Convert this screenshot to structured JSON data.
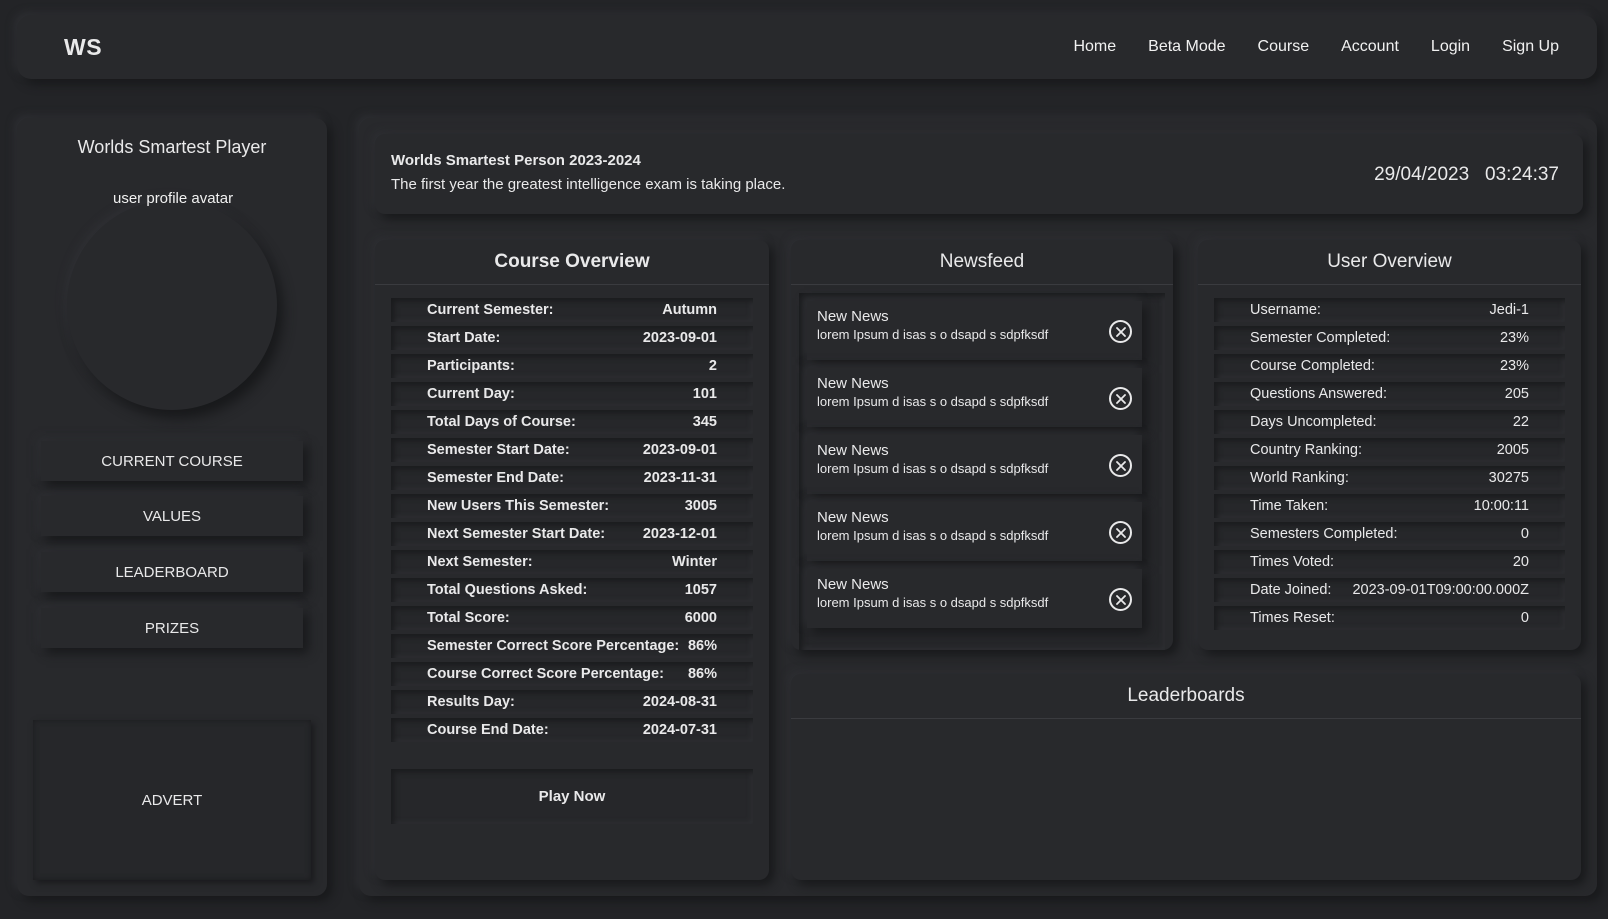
{
  "navbar": {
    "logo": "WS",
    "links": [
      "Home",
      "Beta Mode",
      "Course",
      "Account",
      "Login",
      "Sign Up"
    ]
  },
  "sidebar": {
    "title": "Worlds Smartest Player",
    "avatar_alt": "user profile avatar",
    "buttons": [
      "CURRENT COURSE",
      "VALUES",
      "LEADERBOARD",
      "PRIZES"
    ],
    "advert": "ADVERT"
  },
  "banner": {
    "title": "Worlds Smartest Person 2023-2024",
    "subtitle": "The first year the greatest intelligence exam is taking place.",
    "date": "29/04/2023",
    "time": "03:24:37"
  },
  "course_overview": {
    "title": "Course Overview",
    "rows": [
      {
        "label": "Current Semester:",
        "value": "Autumn"
      },
      {
        "label": "Start Date:",
        "value": "2023-09-01"
      },
      {
        "label": "Participants:",
        "value": "2"
      },
      {
        "label": "Current Day:",
        "value": "101"
      },
      {
        "label": "Total Days of Course:",
        "value": "345"
      },
      {
        "label": "Semester Start Date:",
        "value": "2023-09-01"
      },
      {
        "label": "Semester End Date:",
        "value": "2023-11-31"
      },
      {
        "label": "New Users This Semester:",
        "value": "3005"
      },
      {
        "label": "Next Semester Start Date:",
        "value": "2023-12-01"
      },
      {
        "label": "Next Semester:",
        "value": "Winter"
      },
      {
        "label": "Total Questions Asked:",
        "value": "1057"
      },
      {
        "label": "Total Score:",
        "value": "6000"
      },
      {
        "label": "Semester Correct Score Percentage:",
        "value": "86%"
      },
      {
        "label": "Course Correct Score Percentage:",
        "value": "86%"
      },
      {
        "label": "Results Day:",
        "value": "2024-08-31"
      },
      {
        "label": "Course End Date:",
        "value": "2024-07-31"
      }
    ],
    "play_button": "Play Now"
  },
  "newsfeed": {
    "title": "Newsfeed",
    "items": [
      {
        "title": "New News",
        "body": "lorem Ipsum d isas s o dsapd s sdpfksdf"
      },
      {
        "title": "New News",
        "body": "lorem Ipsum d isas s o dsapd s sdpfksdf"
      },
      {
        "title": "New News",
        "body": "lorem Ipsum d isas s o dsapd s sdpfksdf"
      },
      {
        "title": "New News",
        "body": "lorem Ipsum d isas s o dsapd s sdpfksdf"
      },
      {
        "title": "New News",
        "body": "lorem Ipsum d isas s o dsapd s sdpfksdf"
      }
    ]
  },
  "user_overview": {
    "title": "User Overview",
    "rows": [
      {
        "label": "Username:",
        "value": "Jedi-1"
      },
      {
        "label": "Semester Completed:",
        "value": "23%"
      },
      {
        "label": "Course Completed:",
        "value": "23%"
      },
      {
        "label": "Questions Answered:",
        "value": "205"
      },
      {
        "label": "Days Uncompleted:",
        "value": "22"
      },
      {
        "label": "Country Ranking:",
        "value": "2005"
      },
      {
        "label": "World Ranking:",
        "value": "30275"
      },
      {
        "label": "Time Taken:",
        "value": "10:00:11"
      },
      {
        "label": "Semesters Completed:",
        "value": "0"
      },
      {
        "label": "Times Voted:",
        "value": "20"
      },
      {
        "label": "Date Joined:",
        "value": "2023-09-01T09:00:00.000Z"
      },
      {
        "label": "Times Reset:",
        "value": "0"
      }
    ]
  },
  "leaderboards": {
    "title": "Leaderboards"
  }
}
